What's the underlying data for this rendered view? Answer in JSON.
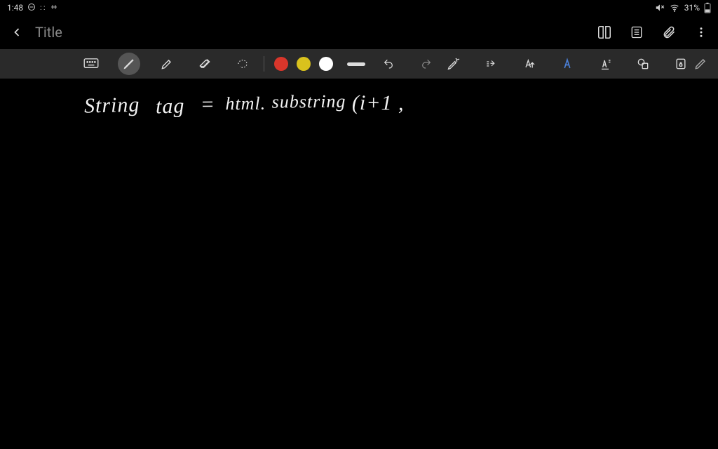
{
  "status": {
    "time": "1:48",
    "battery_pct": "31%"
  },
  "header": {
    "title": "Title"
  },
  "icons": {
    "back": "back-icon",
    "reader": "reader-icon",
    "page": "page-view-icon",
    "attach": "attachment-icon",
    "more": "more-icon",
    "keyboard": "keyboard-icon",
    "pen": "pen-icon",
    "highlighter": "highlighter-icon",
    "eraser": "eraser-icon",
    "lasso": "lasso-icon",
    "undo": "undo-icon",
    "redo": "redo-icon",
    "penSettings": "pen-settings-icon",
    "align": "align-icon",
    "textStyle": "text-style-icon",
    "fontA": "font-a-icon",
    "underlineA": "underline-a-icon",
    "shapes": "shapes-icon",
    "lock": "lock-icon",
    "edit": "edit-icon"
  },
  "toolbar": {
    "colors": {
      "red": "#d9362b",
      "yellow": "#d9c21d",
      "white": "#ffffff"
    },
    "active_tool": "pen"
  },
  "canvas": {
    "handwriting": "String  tag  = html. substring (i+1 ,",
    "w1": "String",
    "w2": "tag",
    "eq": "=",
    "w3": "html.",
    "w4": "substring",
    "w5": "(i+1 ,"
  }
}
